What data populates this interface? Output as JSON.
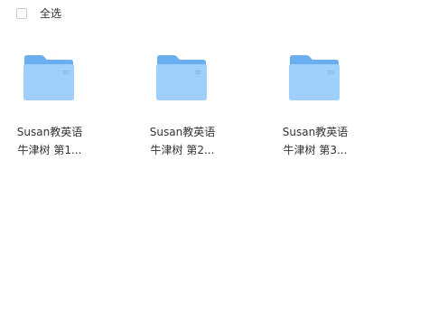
{
  "toolbar": {
    "select_all_label": "全选"
  },
  "folders": [
    {
      "name_line1": "Susan教英语",
      "name_line2": "牛津树 第1..."
    },
    {
      "name_line1": "Susan教英语",
      "name_line2": "牛津树 第2..."
    },
    {
      "name_line1": "Susan教英语",
      "name_line2": "牛津树 第3..."
    }
  ],
  "colors": {
    "folder_back": "#6aaef0",
    "folder_front": "#9fd0fb",
    "checkbox_border": "#c9ced6",
    "text": "#333333"
  },
  "icons": {
    "folder": "folder-icon",
    "checkbox": "checkbox-icon"
  }
}
